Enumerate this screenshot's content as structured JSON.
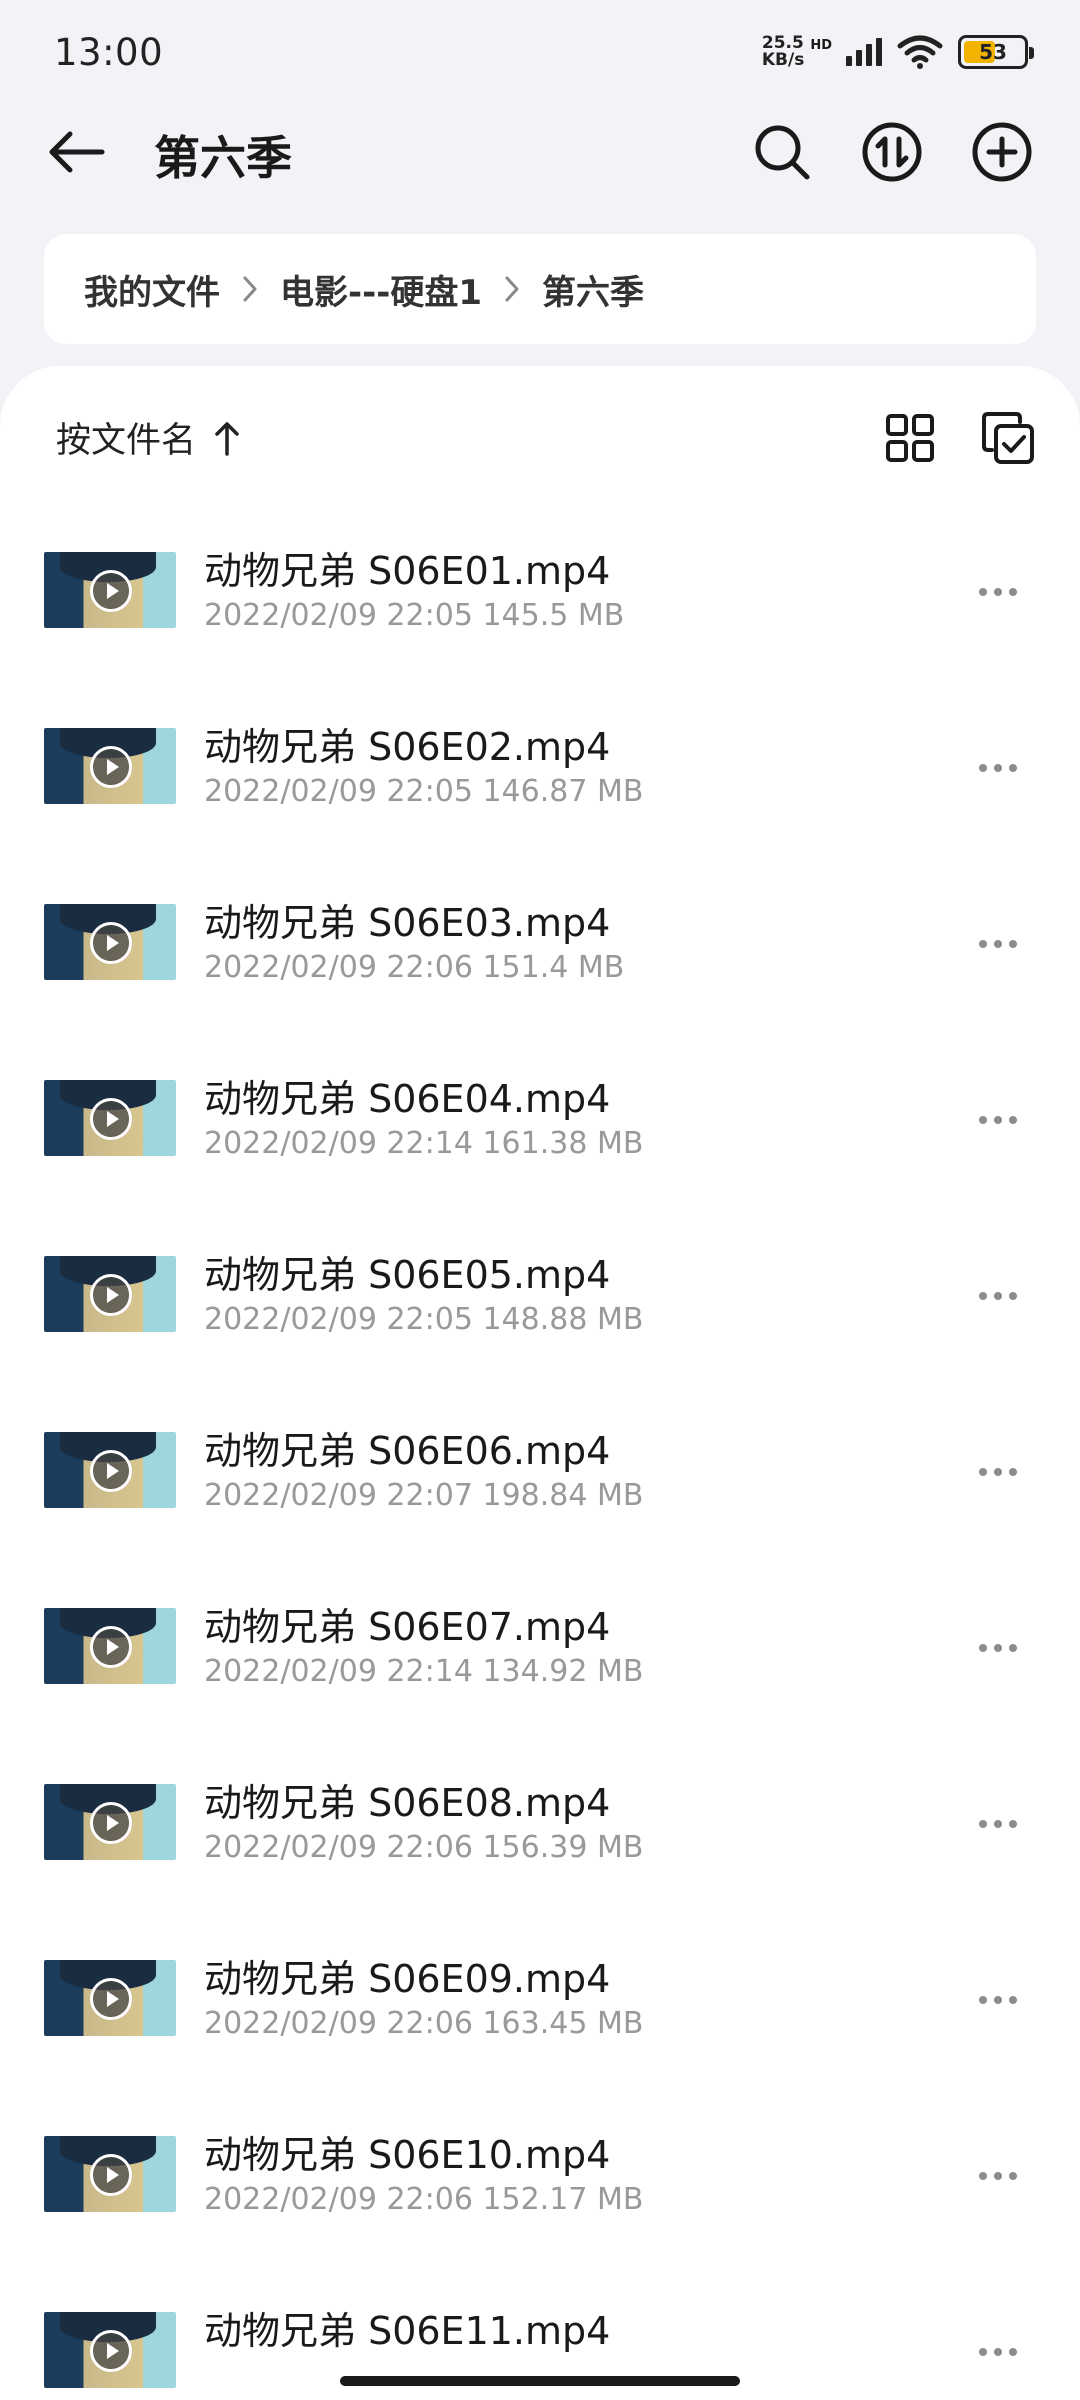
{
  "status_bar": {
    "time": "13:00",
    "net_speed_value": "25.5",
    "net_speed_unit": "KB/s",
    "hd_label": "HD",
    "battery_level": "53",
    "battery_fraction": 0.53
  },
  "header": {
    "title": "第六季",
    "back_icon": "arrow-left-icon",
    "search_icon": "search-icon",
    "transfer_icon": "transfer-icon",
    "add_icon": "add-circle-icon"
  },
  "breadcrumb": {
    "items": [
      "我的文件",
      "电影---硬盘1",
      "第六季"
    ]
  },
  "sort_bar": {
    "label": "按文件名",
    "sort_direction_icon": "arrow-up-icon",
    "grid_view_icon": "grid-view-icon",
    "multi_select_icon": "multi-select-icon"
  },
  "files": [
    {
      "name": "动物兄弟 S06E01.mp4",
      "meta": "2022/02/09 22:05 145.5 MB"
    },
    {
      "name": "动物兄弟 S06E02.mp4",
      "meta": "2022/02/09 22:05 146.87 MB"
    },
    {
      "name": "动物兄弟 S06E03.mp4",
      "meta": "2022/02/09 22:06 151.4 MB"
    },
    {
      "name": "动物兄弟 S06E04.mp4",
      "meta": "2022/02/09 22:14 161.38 MB"
    },
    {
      "name": "动物兄弟 S06E05.mp4",
      "meta": "2022/02/09 22:05 148.88 MB"
    },
    {
      "name": "动物兄弟 S06E06.mp4",
      "meta": "2022/02/09 22:07 198.84 MB"
    },
    {
      "name": "动物兄弟 S06E07.mp4",
      "meta": "2022/02/09 22:14 134.92 MB"
    },
    {
      "name": "动物兄弟 S06E08.mp4",
      "meta": "2022/02/09 22:06 156.39 MB"
    },
    {
      "name": "动物兄弟 S06E09.mp4",
      "meta": "2022/02/09 22:06 163.45 MB"
    },
    {
      "name": "动物兄弟 S06E10.mp4",
      "meta": "2022/02/09 22:06 152.17 MB"
    },
    {
      "name": "动物兄弟 S06E11.mp4",
      "meta": ""
    }
  ],
  "colors": {
    "background": "#f2f3f6",
    "panel": "#ffffff",
    "meta_text": "#999999",
    "battery": "#f3b400"
  }
}
